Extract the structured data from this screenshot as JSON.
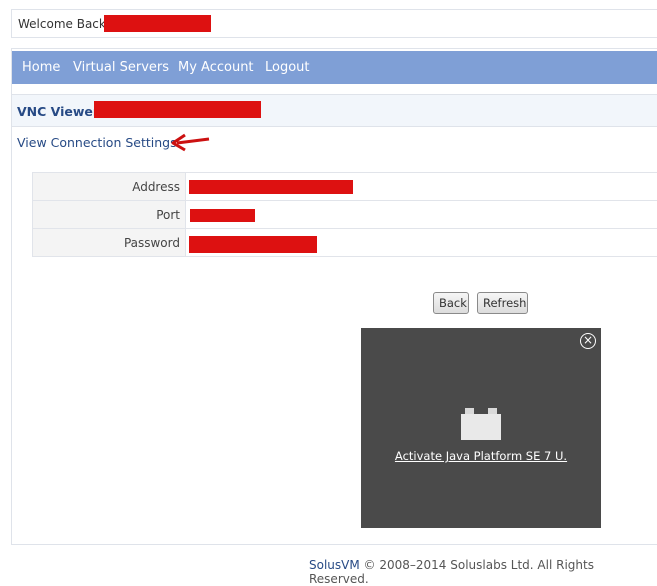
{
  "welcome": {
    "text": "Welcome Back"
  },
  "nav": {
    "items": [
      "Home",
      "Virtual Servers",
      "My Account",
      "Logout"
    ]
  },
  "vnc": {
    "title": "VNC Viewer"
  },
  "connection_link": "View Connection Settings",
  "settings": {
    "address_label": "Address",
    "port_label": "Port",
    "password_label": "Password"
  },
  "buttons": {
    "back": "Back",
    "refresh": "Refresh"
  },
  "java": {
    "activate_label": "Activate Java Platform SE 7 U."
  },
  "footer": {
    "brand": "SolusVM",
    "text": "© 2008–2014 Soluslabs Ltd. All Rights Reserved."
  },
  "colors": {
    "nav_bg": "#7f9fd6",
    "redaction": "#dd1111",
    "link": "#274a85",
    "java_panel": "#4a4a4a"
  }
}
